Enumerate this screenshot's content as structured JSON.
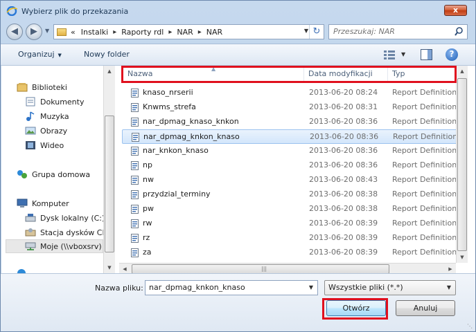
{
  "window": {
    "title": "Wybierz plik do przekazania",
    "close_label": "x"
  },
  "navigation": {
    "back_icon": "back-arrow-icon",
    "forward_icon": "forward-arrow-icon",
    "breadcrumb_prefix": "«",
    "breadcrumb": [
      "Instalki",
      "Raporty rdl",
      "NAR",
      "NAR"
    ],
    "search_placeholder": "Przeszukaj: NAR"
  },
  "toolbar": {
    "organize_label": "Organizuj",
    "new_folder_label": "Nowy folder"
  },
  "sidebar": {
    "items": [
      {
        "label": "Biblioteki",
        "icon": "libraries-icon"
      },
      {
        "label": "Dokumenty",
        "icon": "documents-icon"
      },
      {
        "label": "Muzyka",
        "icon": "music-icon"
      },
      {
        "label": "Obrazy",
        "icon": "pictures-icon"
      },
      {
        "label": "Wideo",
        "icon": "video-icon"
      },
      {
        "label": "Grupa domowa",
        "icon": "homegroup-icon"
      },
      {
        "label": "Komputer",
        "icon": "computer-icon"
      },
      {
        "label": "Dysk lokalny (C:)",
        "icon": "drive-icon"
      },
      {
        "label": "Stacja dysków CD",
        "icon": "cd-drive-icon"
      },
      {
        "label": "Moje (\\\\vboxsrv)",
        "icon": "network-drive-icon"
      }
    ]
  },
  "file_list": {
    "columns": [
      "Nazwa",
      "Data modyfikacji",
      "Typ"
    ],
    "files": [
      {
        "name": "knaso_nrserii",
        "date": "2013-06-20 08:24",
        "type": "Report Definition"
      },
      {
        "name": "Knwms_strefa",
        "date": "2013-06-20 08:31",
        "type": "Report Definition"
      },
      {
        "name": "nar_dpmag_knaso_knkon",
        "date": "2013-06-20 08:36",
        "type": "Report Definition"
      },
      {
        "name": "nar_dpmag_knkon_knaso",
        "date": "2013-06-20 08:36",
        "type": "Report Definition"
      },
      {
        "name": "nar_knkon_knaso",
        "date": "2013-06-20 08:36",
        "type": "Report Definition"
      },
      {
        "name": "np",
        "date": "2013-06-20 08:36",
        "type": "Report Definition"
      },
      {
        "name": "nw",
        "date": "2013-06-20 08:43",
        "type": "Report Definition"
      },
      {
        "name": "przydzial_terminy",
        "date": "2013-06-20 08:38",
        "type": "Report Definition"
      },
      {
        "name": "pw",
        "date": "2013-06-20 08:38",
        "type": "Report Definition"
      },
      {
        "name": "rw",
        "date": "2013-06-20 08:39",
        "type": "Report Definition"
      },
      {
        "name": "rz",
        "date": "2013-06-20 08:39",
        "type": "Report Definition"
      },
      {
        "name": "za",
        "date": "2013-06-20 08:39",
        "type": "Report Definition"
      }
    ],
    "selected_index": 3
  },
  "footer": {
    "filename_label": "Nazwa pliku:",
    "filename_value": "nar_dpmag_knkon_knaso",
    "filter_value": "Wszystkie pliki (*.*)",
    "open_label": "Otwórz",
    "cancel_label": "Anuluj"
  },
  "colors": {
    "highlight": "#e0101e",
    "selection": "#d3e6fb"
  }
}
